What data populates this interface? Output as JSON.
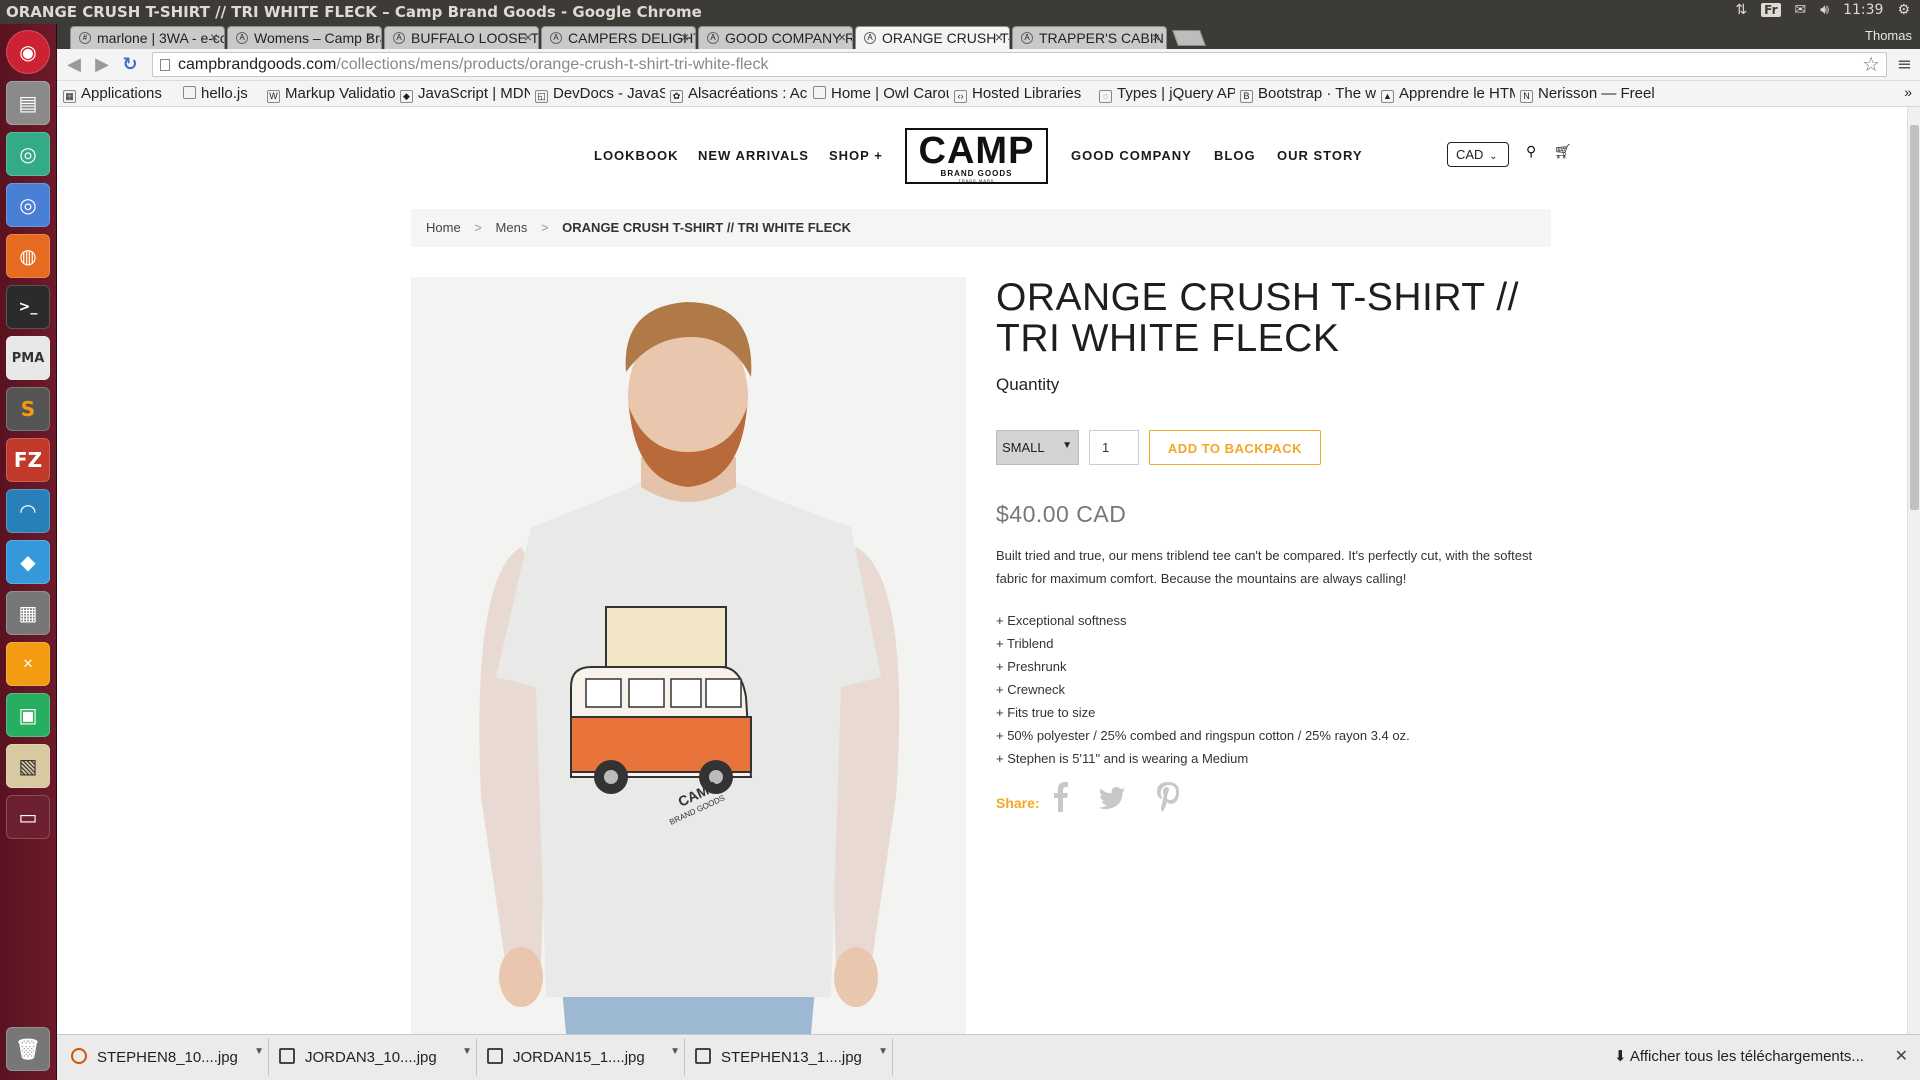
{
  "window": {
    "title": "ORANGE CRUSH T-SHIRT // TRI WHITE FLECK – Camp Brand Goods - Google Chrome"
  },
  "system": {
    "keyboard": "Fr",
    "time": "11:39",
    "user": "Thomas"
  },
  "tabs": [
    {
      "label": "marlone | 3WA - e-co",
      "icon": "hash-icon"
    },
    {
      "label": "Womens – Camp Bra",
      "icon": "camp-icon"
    },
    {
      "label": "BUFFALO LOOSE T-S",
      "icon": "camp-icon"
    },
    {
      "label": "CAMPERS DELIGHT L",
      "icon": "camp-icon"
    },
    {
      "label": "GOOD COMPANY RA",
      "icon": "camp-icon"
    },
    {
      "label": "ORANGE CRUSH T-SH",
      "icon": "camp-icon"
    },
    {
      "label": "TRAPPER'S CABIN T-",
      "icon": "camp-icon"
    }
  ],
  "omnibox": {
    "domain": "campbrandgoods.com",
    "path": "/collections/mens/products/orange-crush-t-shirt-tri-white-fleck"
  },
  "bookmarks": [
    "Applications",
    "hello.js",
    "Markup Validatio",
    "JavaScript | MDN",
    "DevDocs - JavaSc",
    "Alsacréations : Ac",
    "Home | Owl Carou",
    "Hosted Libraries",
    "Types | jQuery AP",
    "Bootstrap · The w",
    "Apprendre le HTM",
    "Nerisson — Freel"
  ],
  "site": {
    "nav_left": [
      "LOOKBOOK",
      "NEW ARRIVALS",
      "SHOP +"
    ],
    "nav_right": [
      "GOOD COMPANY",
      "BLOG",
      "OUR STORY"
    ],
    "logo": {
      "text": "CAMP",
      "sub": "BRAND GOODS",
      "tiny": "TRADE MARK"
    },
    "currency": "CAD",
    "breadcrumb": [
      "Home",
      "Mens",
      "ORANGE CRUSH T-SHIRT // TRI WHITE FLECK"
    ],
    "shirt_print": {
      "brand": "CAMP",
      "sub": "BRAND GOODS"
    }
  },
  "product": {
    "title": "ORANGE CRUSH T-SHIRT // TRI WHITE FLECK",
    "quantity_label": "Quantity",
    "size": "SMALL",
    "quantity": "1",
    "add_button": "ADD TO BACKPACK",
    "price": "$40.00 CAD",
    "description": "Built tried and true, our mens triblend tee can't be compared. It's perfectly cut, with the softest fabric for maximum comfort. Because the mountains are always calling!",
    "features": [
      "+ Exceptional softness",
      "+ Triblend",
      "+ Preshrunk",
      "+ Crewneck",
      "+ Fits true to size",
      "+ 50% polyester / 25% combed and ringspun cotton / 25% rayon 3.4 oz.",
      "+ Stephen is 5'11\" and is wearing a Medium"
    ],
    "share_label": "Share:"
  },
  "downloads": {
    "items": [
      "STEPHEN8_10....jpg",
      "JORDAN3_10....jpg",
      "JORDAN15_1....jpg",
      "STEPHEN13_1....jpg"
    ],
    "show_all": "Afficher tous les téléchargements..."
  },
  "colors": {
    "accent": "#f5a623",
    "launcher": "#5d1523",
    "van_orange": "#e8743b"
  }
}
